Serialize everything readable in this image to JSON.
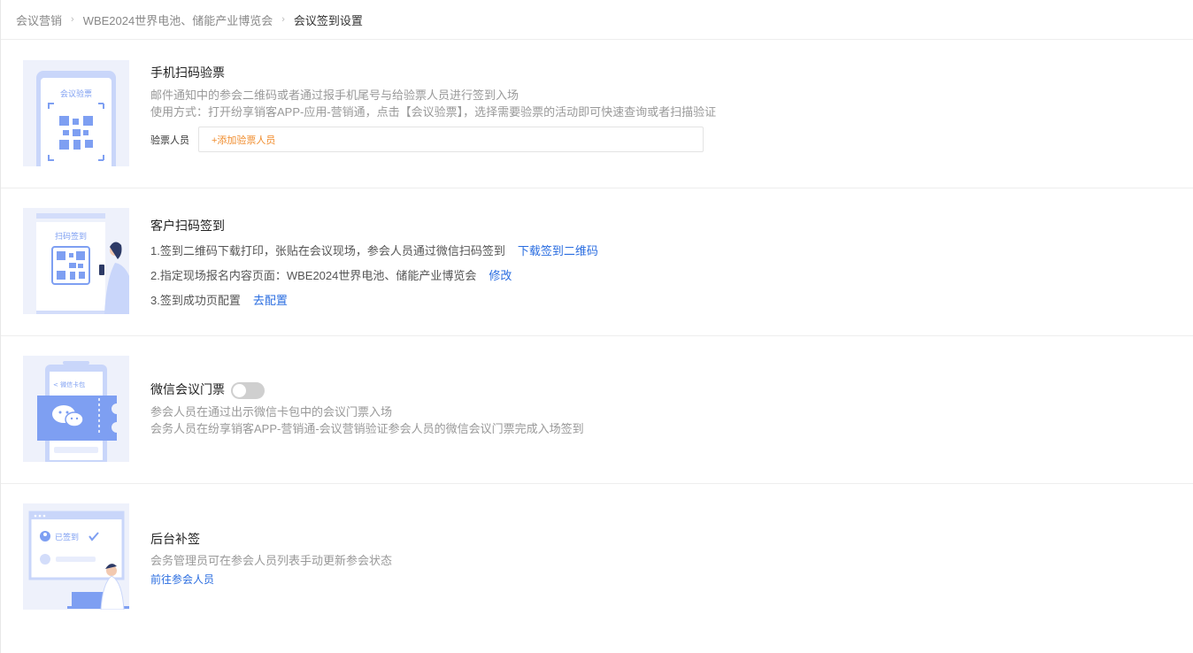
{
  "breadcrumb": {
    "items": [
      "会议营销",
      "WBE2024世界电池、储能产业博览会",
      "会议签到设置"
    ],
    "separator": "›"
  },
  "section1": {
    "title": "手机扫码验票",
    "desc1": "邮件通知中的参会二维码或者通过报手机尾号与给验票人员进行签到入场",
    "desc2": "使用方式：打开纷享销客APP-应用-营销通，点击【会议验票】，选择需要验票的活动即可快速查询或者扫描验证",
    "checker_label": "验票人员",
    "add_checker": "+添加验票人员",
    "illus_label": "会议验票"
  },
  "section2": {
    "title": "客户扫码签到",
    "line1": "1.签到二维码下载打印，张贴在会议现场，参会人员通过微信扫码签到",
    "line1_link": "下载签到二维码",
    "line2": "2.指定现场报名内容页面：WBE2024世界电池、储能产业博览会",
    "line2_link": "修改",
    "line3": "3.签到成功页配置",
    "line3_link": "去配置",
    "illus_label": "扫码签到"
  },
  "section3": {
    "title": "微信会议门票",
    "toggle_on": false,
    "desc1": "参会人员在通过出示微信卡包中的会议门票入场",
    "desc2": "会务人员在纷享销客APP-营销通-会议营销验证参会人员的微信会议门票完成入场签到",
    "illus_label": "< 微信卡包"
  },
  "section4": {
    "title": "后台补签",
    "desc": "会务管理员可在参会人员列表手动更新参会状态",
    "link": "前往参会人员",
    "illus_label": "已签到"
  },
  "colors": {
    "accent": "#2a6de0",
    "orange": "#f08c2c",
    "illus_bg": "#eef1fb",
    "illus_blue": "#7e9ff2"
  }
}
